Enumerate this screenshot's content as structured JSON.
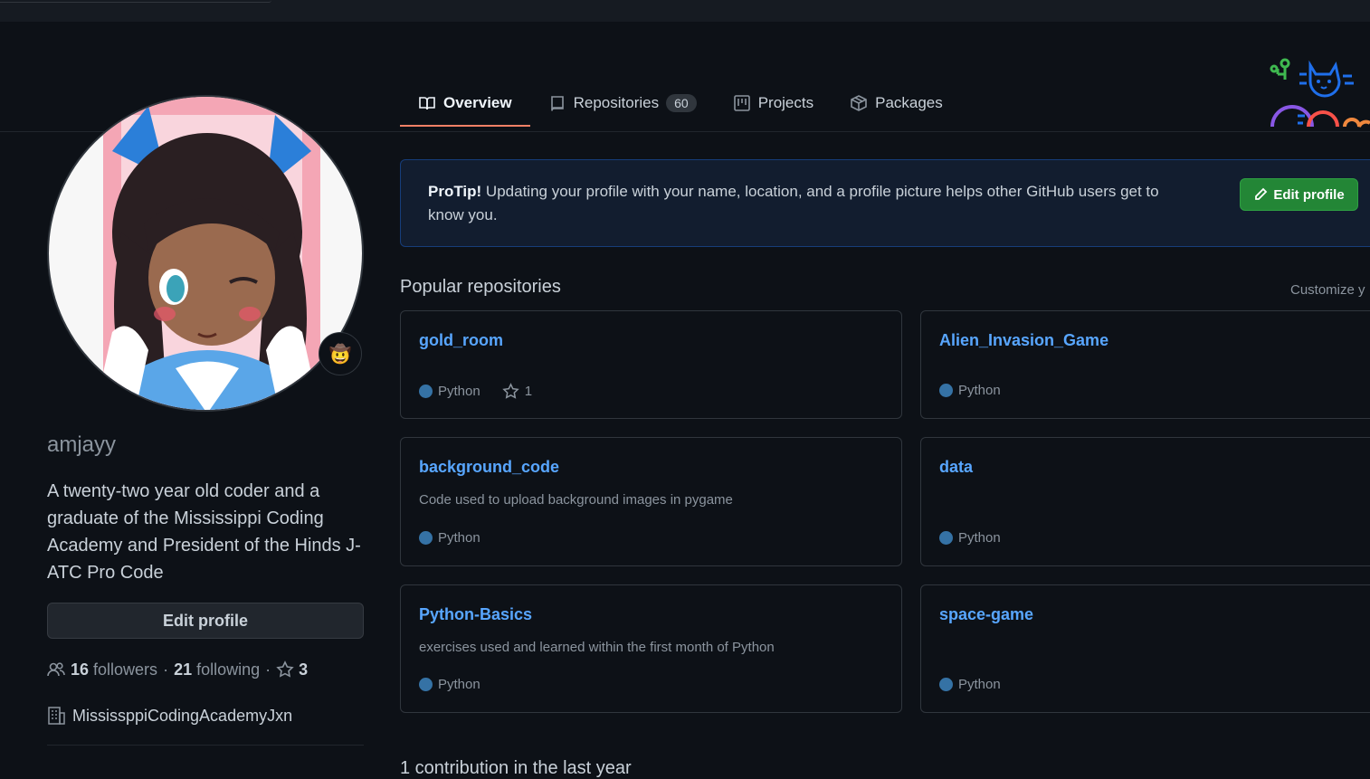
{
  "tabs": [
    {
      "label": "Overview",
      "icon": "book-icon",
      "active": true
    },
    {
      "label": "Repositories",
      "icon": "repo-icon",
      "count": "60"
    },
    {
      "label": "Projects",
      "icon": "project-icon"
    },
    {
      "label": "Packages",
      "icon": "package-icon"
    }
  ],
  "profile": {
    "username": "amjayy",
    "bio": "A twenty-two year old coder and a graduate of the Mississippi Coding Academy and President of the Hinds J-ATC Pro Code",
    "edit_label": "Edit profile",
    "followers_count": "16",
    "followers_label": "followers",
    "following_count": "21",
    "following_label": "following",
    "stars_count": "3",
    "separator": "·",
    "organization": "MississppiCodingAcademyJxn",
    "status_emoji": "🤠"
  },
  "protip": {
    "lead": "ProTip!",
    "text": "Updating your profile with your name, location, and a profile picture helps other GitHub users get to know you.",
    "button": "Edit profile"
  },
  "popular": {
    "title": "Popular repositories",
    "customize": "Customize y"
  },
  "repos": [
    {
      "name": "gold_room",
      "desc": "",
      "lang": "Python",
      "stars": "1"
    },
    {
      "name": "Alien_Invasion_Game",
      "desc": "",
      "lang": "Python",
      "stars": ""
    },
    {
      "name": "background_code",
      "desc": "Code used to upload background images in pygame",
      "lang": "Python",
      "stars": ""
    },
    {
      "name": "data",
      "desc": "",
      "lang": "Python",
      "stars": ""
    },
    {
      "name": "Python-Basics",
      "desc": "exercises used and learned within the first month of Python",
      "lang": "Python",
      "stars": ""
    },
    {
      "name": "space-game",
      "desc": "",
      "lang": "Python",
      "stars": ""
    }
  ],
  "colors": {
    "accent_link": "#58a6ff",
    "python_lang": "#3572a5",
    "tab_underline": "#f78166",
    "primary_button": "#238636"
  },
  "contributions": {
    "text": "1 contribution in the last year"
  }
}
